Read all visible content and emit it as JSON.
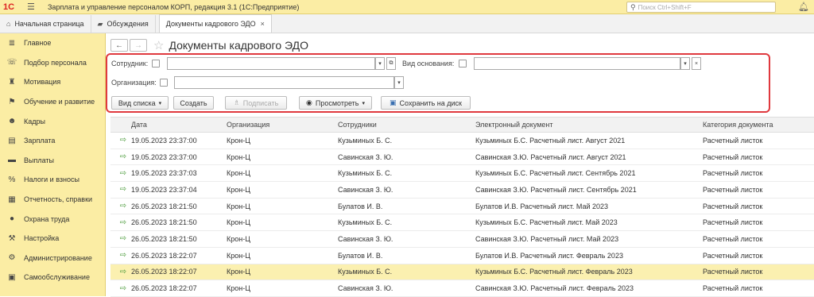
{
  "app": {
    "logo": "1С",
    "title": "Зарплата и управление персоналом КОРП, редакция 3.1  (1С:Предприятие)",
    "search_placeholder": "Поиск Ctrl+Shift+F"
  },
  "tabs": [
    {
      "label": "Начальная страница",
      "icon": "home-icon"
    },
    {
      "label": "Обсуждения",
      "icon": "chat-icon"
    },
    {
      "label": "Документы кадрового ЭДО",
      "icon": "",
      "active": true
    }
  ],
  "sidebar": {
    "items": [
      {
        "label": "Главное",
        "icon": "menu-icon"
      },
      {
        "label": "Подбор персонала",
        "icon": "recruit-icon"
      },
      {
        "label": "Мотивация",
        "icon": "motivation-icon"
      },
      {
        "label": "Обучение и развитие",
        "icon": "education-icon"
      },
      {
        "label": "Кадры",
        "icon": "people-icon"
      },
      {
        "label": "Зарплата",
        "icon": "salary-icon"
      },
      {
        "label": "Выплаты",
        "icon": "payments-icon"
      },
      {
        "label": "Налоги и взносы",
        "icon": "percent-icon"
      },
      {
        "label": "Отчетность, справки",
        "icon": "reports-icon"
      },
      {
        "label": "Охрана труда",
        "icon": "safety-icon"
      },
      {
        "label": "Настройка",
        "icon": "wrench-icon"
      },
      {
        "label": "Администрирование",
        "icon": "gear-icon"
      },
      {
        "label": "Самообслуживание",
        "icon": "selfservice-icon"
      }
    ]
  },
  "page": {
    "title": "Документы кадрового ЭДО"
  },
  "filters": {
    "employee_label": "Сотрудник:",
    "employee_value": "",
    "basis_label": "Вид основания:",
    "basis_value": "",
    "org_label": "Организация:",
    "org_value": ""
  },
  "toolbar": {
    "view_list": "Вид списка",
    "create": "Создать",
    "sign": "Подписать",
    "view": "Просмотреть",
    "save_to_disk": "Сохранить на диск"
  },
  "table": {
    "columns": [
      "Дата",
      "Организация",
      "Сотрудники",
      "Электронный документ",
      "Категория документа"
    ],
    "rows": [
      [
        "19.05.2023 23:37:00",
        "Крон-Ц",
        "Кузьминых Б. С.",
        "Кузьминых Б.С. Расчетный лист. Август 2021",
        "Расчетный листок"
      ],
      [
        "19.05.2023 23:37:00",
        "Крон-Ц",
        "Савинская З. Ю.",
        "Савинская З.Ю. Расчетный лист. Август 2021",
        "Расчетный листок"
      ],
      [
        "19.05.2023 23:37:03",
        "Крон-Ц",
        "Кузьминых Б. С.",
        "Кузьминых Б.С. Расчетный лист. Сентябрь 2021",
        "Расчетный листок"
      ],
      [
        "19.05.2023 23:37:04",
        "Крон-Ц",
        "Савинская З. Ю.",
        "Савинская З.Ю. Расчетный лист. Сентябрь 2021",
        "Расчетный листок"
      ],
      [
        "26.05.2023 18:21:50",
        "Крон-Ц",
        "Булатов И. В.",
        "Булатов И.В. Расчетный лист. Май 2023",
        "Расчетный листок"
      ],
      [
        "26.05.2023 18:21:50",
        "Крон-Ц",
        "Кузьминых Б. С.",
        "Кузьминых Б.С. Расчетный лист. Май 2023",
        "Расчетный листок"
      ],
      [
        "26.05.2023 18:21:50",
        "Крон-Ц",
        "Савинская З. Ю.",
        "Савинская З.Ю. Расчетный лист. Май 2023",
        "Расчетный листок"
      ],
      [
        "26.05.2023 18:22:07",
        "Крон-Ц",
        "Булатов И. В.",
        "Булатов И.В. Расчетный лист. Февраль 2023",
        "Расчетный листок"
      ],
      [
        "26.05.2023 18:22:07",
        "Крон-Ц",
        "Кузьминых Б. С.",
        "Кузьминых Б.С. Расчетный лист. Февраль 2023",
        "Расчетный листок"
      ],
      [
        "26.05.2023 18:22:07",
        "Крон-Ц",
        "Савинская З. Ю.",
        "Савинская З.Ю. Расчетный лист. Февраль 2023",
        "Расчетный листок"
      ]
    ],
    "selected_row": 8
  },
  "colors": {
    "sidebar_bg": "#fbeda4",
    "highlight_frame": "#e0393e",
    "selected_row": "#fbf0b0"
  }
}
